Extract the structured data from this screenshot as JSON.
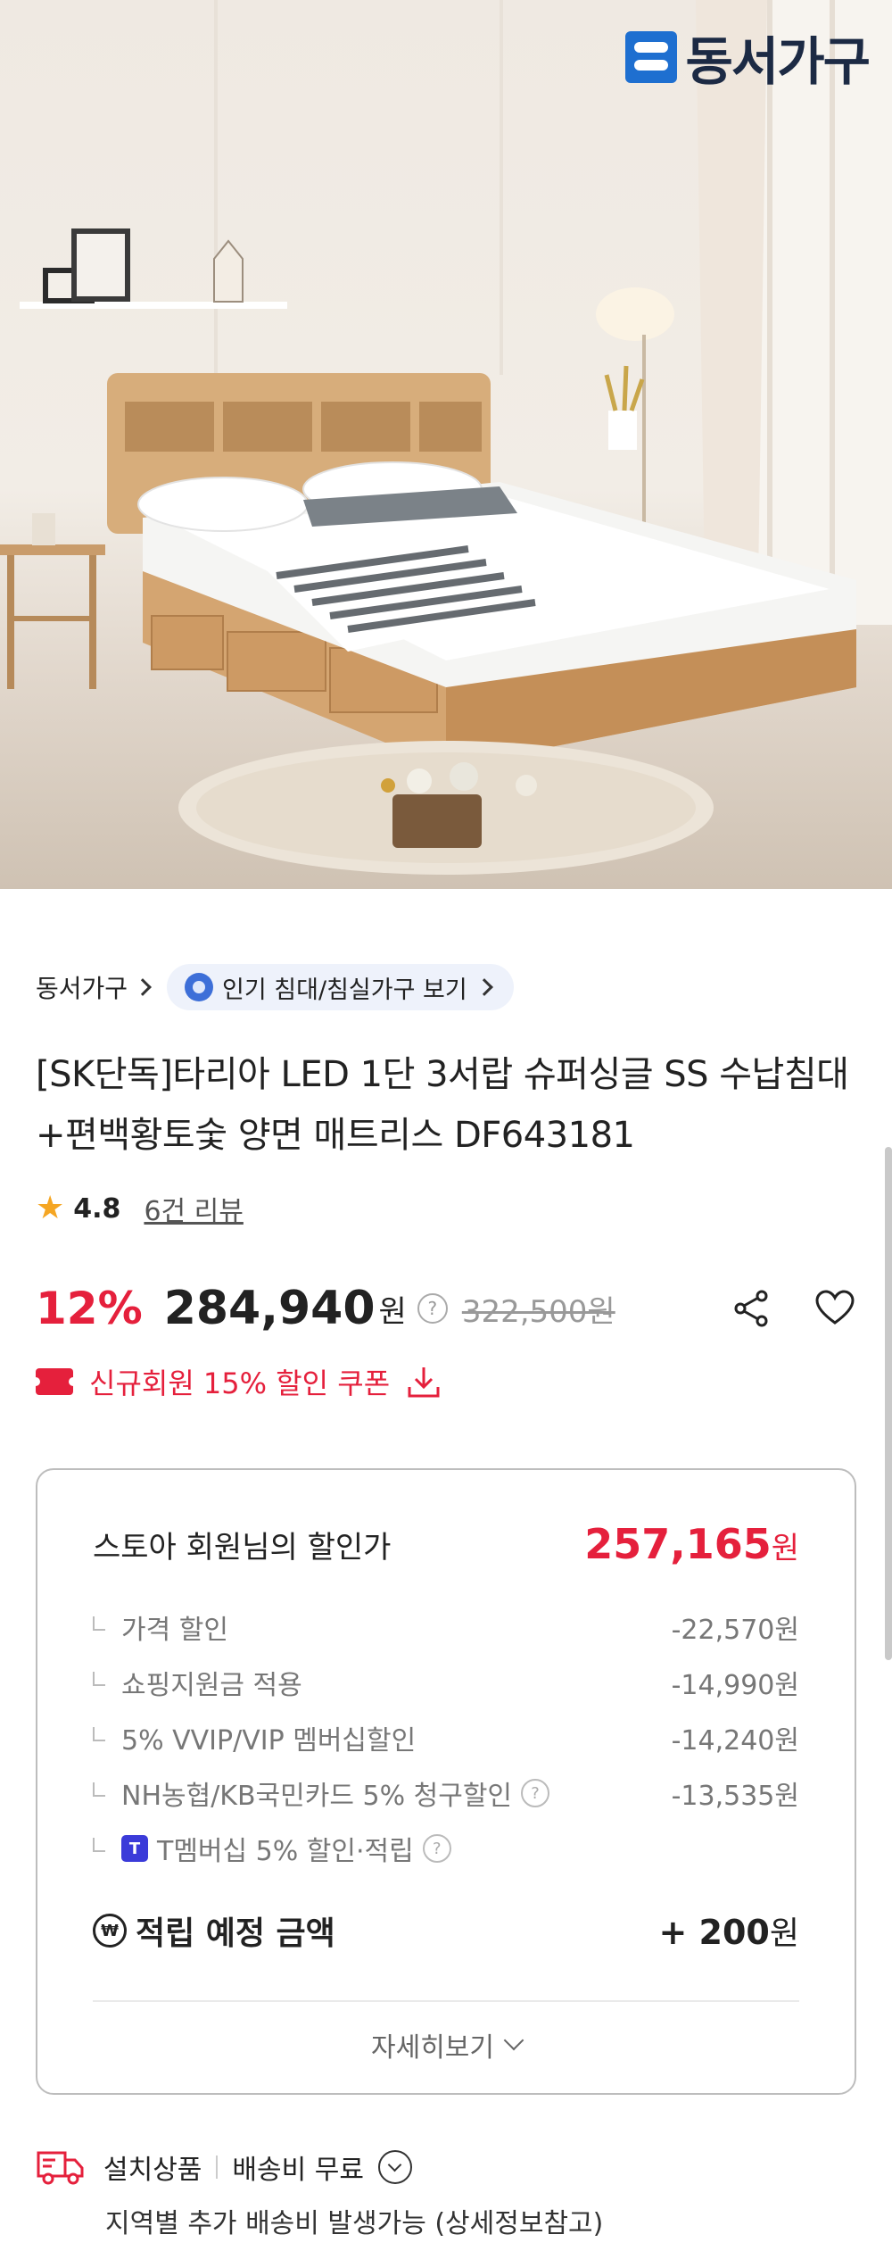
{
  "hero": {
    "brand_name": "동서가구"
  },
  "breadcrumb": {
    "store_label": "동서가구",
    "category_pill": "인기 침대/침실가구 보기"
  },
  "product": {
    "title": "[SK단독]타리아 LED 1단 3서랍 슈퍼싱글 SS 수납침대+편백황토숯 양면 매트리스 DF643181",
    "rating": "4.8",
    "review_link": "6건 리뷰"
  },
  "price": {
    "discount_rate": "12%",
    "sale_price": "284,940",
    "currency": "원",
    "help": "?",
    "original_price": "322,500원"
  },
  "coupon": {
    "label": "신규회원 15% 할인 쿠폰"
  },
  "member_box": {
    "heading": "스토아 회원님의 할인가",
    "member_price": "257,165",
    "member_currency": "원",
    "lines": [
      {
        "label": "가격 할인",
        "amount": "-22,570원"
      },
      {
        "label": "쇼핑지원금 적용",
        "amount": "-14,990원"
      },
      {
        "label": "5% VVIP/VIP 멤버십할인",
        "amount": "-14,240원"
      },
      {
        "label": "NH농협/KB국민카드 5% 청구할인",
        "amount": "-13,535원"
      },
      {
        "label": "T멤버십 5% 할인·적립",
        "amount": ""
      }
    ],
    "points_label": "적립 예정 금액",
    "points_amount": "+ 200",
    "points_currency": "원",
    "more_label": "자세히보기"
  },
  "shipping": {
    "type": "설치상품",
    "fee": "배송비 무료",
    "note": "지역별 추가 배송비 발생가능 (상세정보참고)"
  },
  "colors": {
    "accent": "#e5203c",
    "brand_blue": "#1e6fd0",
    "pill_bg": "#eef2fb"
  },
  "icons": [
    "brand-logo-icon",
    "chevron-right-icon",
    "medal-icon",
    "star-icon",
    "help-icon",
    "share-icon",
    "heart-icon",
    "coupon-ticket-icon",
    "download-icon",
    "won-coin-icon",
    "t-membership-icon",
    "chevron-down-icon",
    "delivery-truck-icon"
  ]
}
